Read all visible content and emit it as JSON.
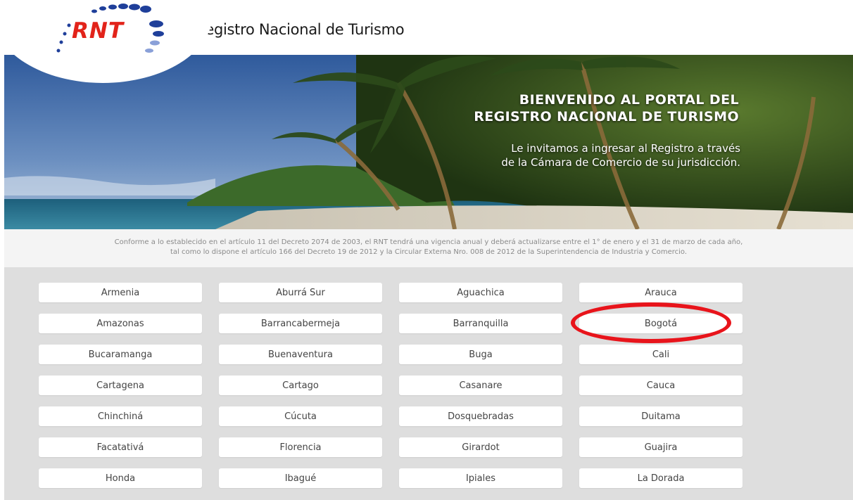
{
  "header": {
    "logo_text": "RNT",
    "site_title": "Registro Nacional de Turismo"
  },
  "banner": {
    "title_line1": "BIENVENIDO AL PORTAL DEL",
    "title_line2": "REGISTRO NACIONAL DE TURISMO",
    "subtitle_line1": "Le invitamos a ingresar al Registro a través",
    "subtitle_line2": "de la Cámara de Comercio de su jurisdicción."
  },
  "notice": {
    "line1": "Conforme a lo establecido en el artículo 11 del Decreto 2074 de 2003, el RNT tendrá una vigencia anual y deberá actualizarse entre el 1° de enero y el 31 de marzo de cada año,",
    "line2": "tal como lo dispone el artículo 166 del Decreto 19 de 2012 y la Circular Externa Nro. 008 de 2012 de la Superintendencia de Industria y Comercio."
  },
  "cities": [
    "Armenia",
    "Aburrá Sur",
    "Aguachica",
    "Arauca",
    "Amazonas",
    "Barrancabermeja",
    "Barranquilla",
    "Bogotá",
    "Bucaramanga",
    "Buenaventura",
    "Buga",
    "Cali",
    "Cartagena",
    "Cartago",
    "Casanare",
    "Cauca",
    "Chinchiná",
    "Cúcuta",
    "Dosquebradas",
    "Duitama",
    "Facatativá",
    "Florencia",
    "Girardot",
    "Guajira",
    "Honda",
    "Ibagué",
    "Ipiales",
    "La Dorada"
  ],
  "colors": {
    "brand_red": "#e2231a",
    "brand_blue": "#1f3f9a",
    "highlight_red": "#e8141b",
    "grid_bg": "#dedede"
  }
}
